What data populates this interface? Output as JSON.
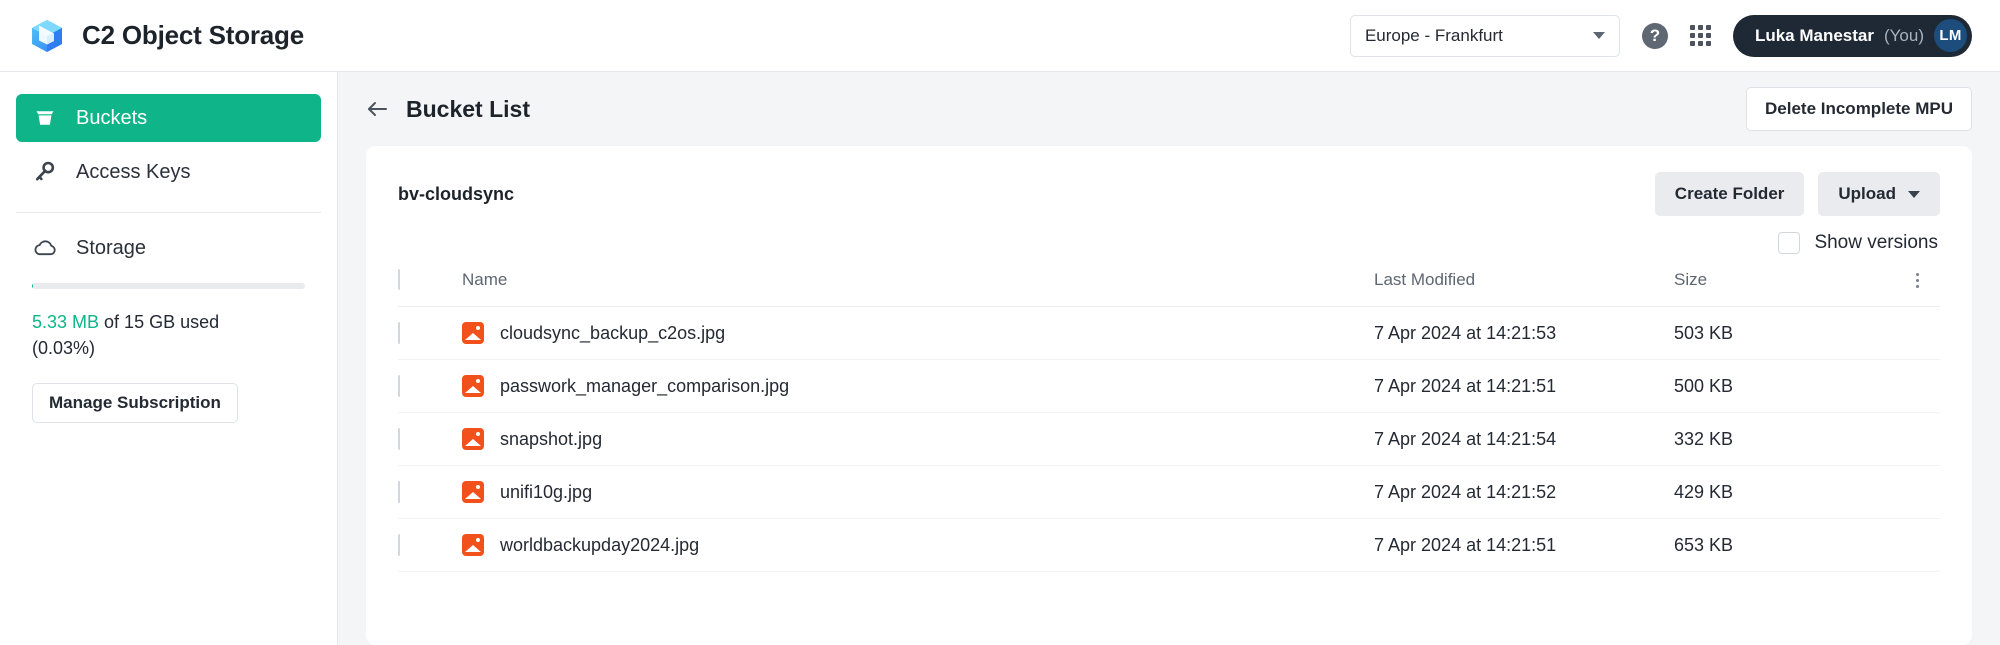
{
  "app": {
    "title": "C2 Object Storage",
    "logo_icon": "cube-logo-icon"
  },
  "header": {
    "region_value": "Europe - Frankfurt",
    "region_caret_icon": "chevron-down-icon",
    "help_icon": "question-mark-icon",
    "help_label": "?",
    "apps_icon": "apps-grid-icon",
    "user_name": "Luka Manestar",
    "user_you": "(You)",
    "user_initials": "LM"
  },
  "sidebar": {
    "items": [
      {
        "label": "Buckets",
        "icon": "bucket-icon",
        "active": true
      },
      {
        "label": "Access Keys",
        "icon": "key-icon",
        "active": false
      }
    ],
    "storage": {
      "label": "Storage",
      "icon": "cloud-icon",
      "used": "5.33 MB",
      "of_text": " of 15 GB used",
      "percent_text": "(0.03%)",
      "percent_value": 0.03,
      "accent_color": "#0fb588",
      "manage_button": "Manage Subscription"
    }
  },
  "page": {
    "back_icon": "back-arrow-icon",
    "title": "Bucket List",
    "delete_mpu_button": "Delete Incomplete MPU"
  },
  "bucket": {
    "name": "bv-cloudsync",
    "create_folder_button": "Create Folder",
    "upload_button": "Upload",
    "upload_caret_icon": "chevron-down-icon",
    "show_versions_label": "Show versions",
    "show_versions_checked": false
  },
  "table": {
    "columns": {
      "name": "Name",
      "last_modified": "Last Modified",
      "size": "Size",
      "menu_icon": "kebab-menu-icon"
    },
    "rows": [
      {
        "icon": "image-file-icon",
        "name": "cloudsync_backup_c2os.jpg",
        "last_modified": "7 Apr 2024 at 14:21:53",
        "size": "503 KB"
      },
      {
        "icon": "image-file-icon",
        "name": "passwork_manager_comparison.jpg",
        "last_modified": "7 Apr 2024 at 14:21:51",
        "size": "500 KB"
      },
      {
        "icon": "image-file-icon",
        "name": "snapshot.jpg",
        "last_modified": "7 Apr 2024 at 14:21:54",
        "size": "332 KB"
      },
      {
        "icon": "image-file-icon",
        "name": "unifi10g.jpg",
        "last_modified": "7 Apr 2024 at 14:21:52",
        "size": "429 KB"
      },
      {
        "icon": "image-file-icon",
        "name": "worldbackupday2024.jpg",
        "last_modified": "7 Apr 2024 at 14:21:51",
        "size": "653 KB"
      }
    ]
  },
  "colors": {
    "accent_green": "#0fb588",
    "file_icon_orange": "#f2511b",
    "avatar_blue": "#1c4d7c",
    "pill_dark": "#1e2935",
    "page_bg": "#f4f5f7"
  }
}
